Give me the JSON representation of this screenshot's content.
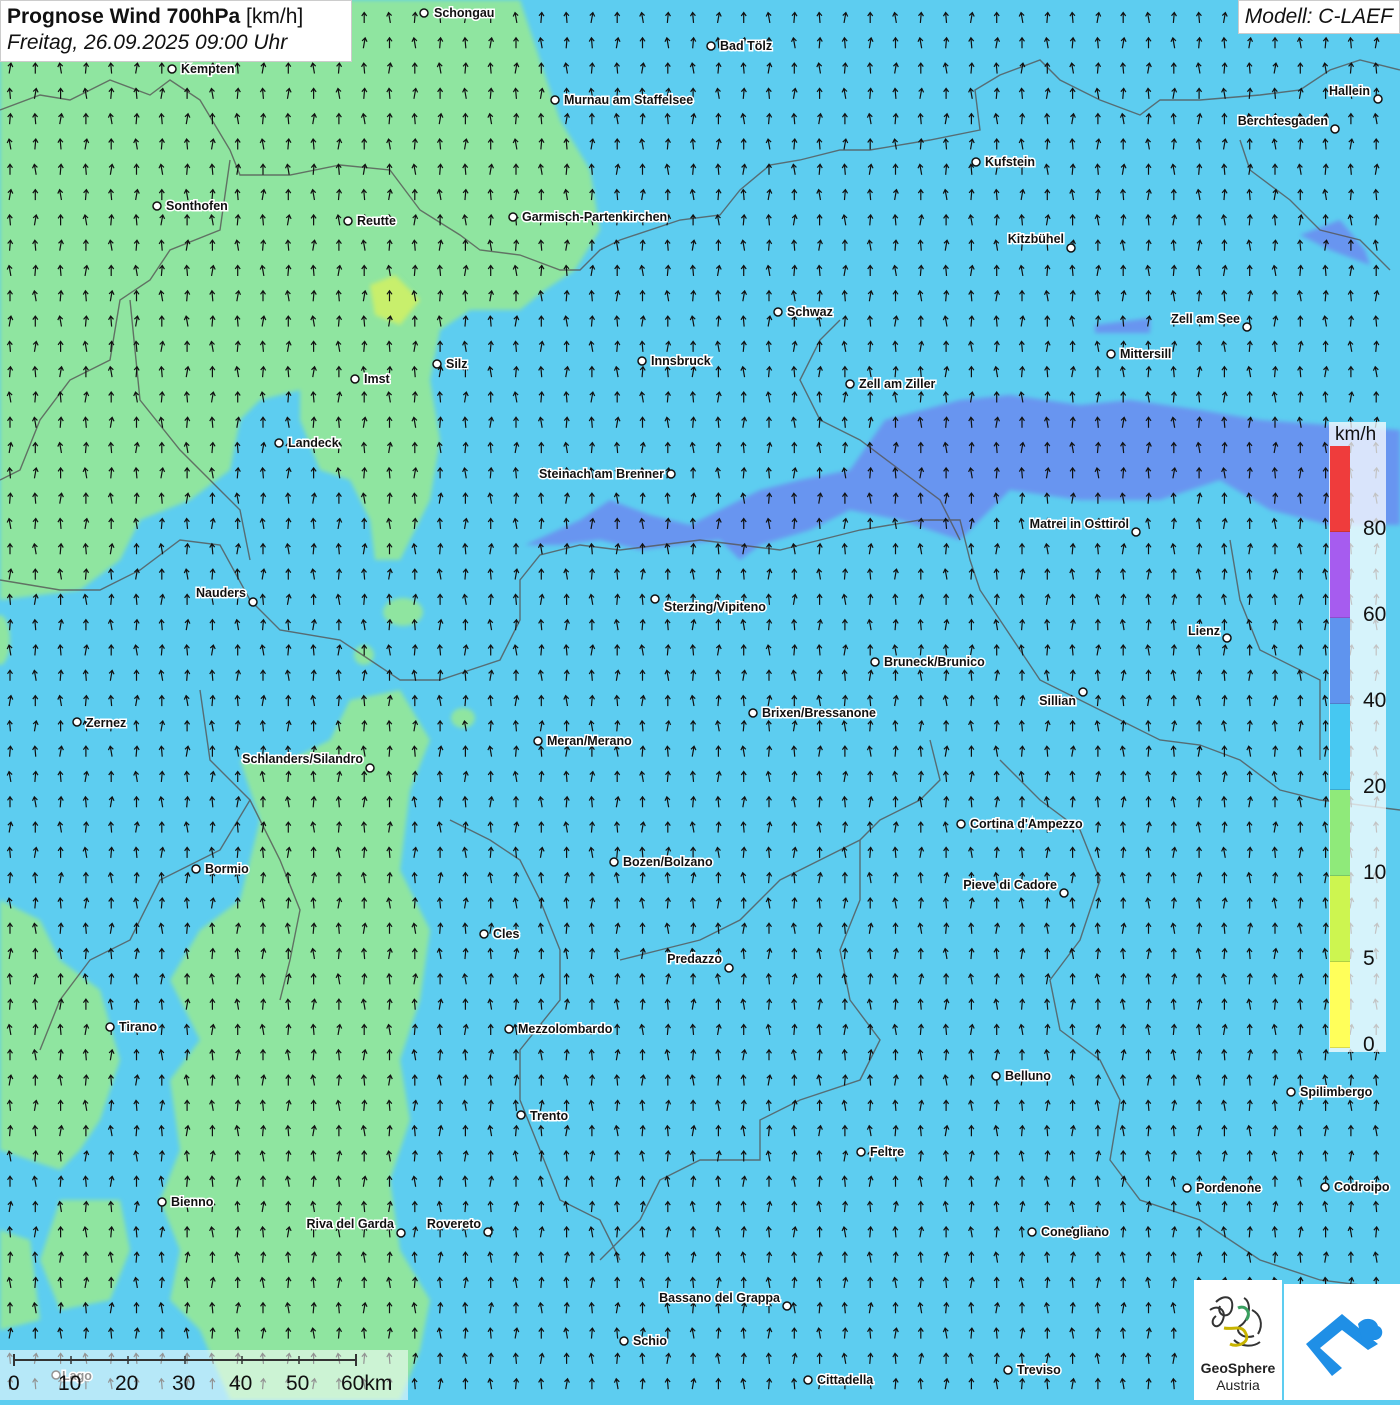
{
  "header": {
    "title_bold": "Prognose Wind 700hPa",
    "title_unit": "[km/h]",
    "datetime": "Freitag, 26.09.2025 09:00 Uhr"
  },
  "model": "Modell: C-LAEF",
  "legend": {
    "unit": "km/h",
    "stops": [
      {
        "label": "0",
        "color": "#ffff5a"
      },
      {
        "label": "5",
        "color": "#cdf550"
      },
      {
        "label": "10",
        "color": "#8fea7a"
      },
      {
        "label": "20",
        "color": "#46c8f2"
      },
      {
        "label": "40",
        "color": "#5f94ee"
      },
      {
        "label": "60",
        "color": "#a65cef"
      },
      {
        "label": "80",
        "color": "#ef3c3c"
      }
    ]
  },
  "scalebar": {
    "labels": [
      "0",
      "10",
      "20",
      "30",
      "40",
      "50",
      "60km"
    ]
  },
  "logo": {
    "name_bold": "GeoSphere",
    "name_sub": "Austria"
  },
  "colors": {
    "base_field": "#5dcdf0",
    "calm_field": "#8fe5a0",
    "strong_field": "#6a8ff0",
    "arrow": "#111111",
    "borders": "#555555"
  },
  "cities": [
    {
      "name": "Schongau"
    },
    {
      "name": "Bad Tölz"
    },
    {
      "name": "Kempten"
    },
    {
      "name": "Murnau am Staffelsee"
    },
    {
      "name": "Hallein"
    },
    {
      "name": "Berchtesgaden"
    },
    {
      "name": "Kufstein"
    },
    {
      "name": "Sonthofen"
    },
    {
      "name": "Reutte"
    },
    {
      "name": "Garmisch-Partenkirchen"
    },
    {
      "name": "Kitzbühel"
    },
    {
      "name": "Schwaz"
    },
    {
      "name": "Zell am See"
    },
    {
      "name": "Mittersill"
    },
    {
      "name": "Imst"
    },
    {
      "name": "Silz"
    },
    {
      "name": "Innsbruck"
    },
    {
      "name": "Zell am Ziller"
    },
    {
      "name": "Landeck"
    },
    {
      "name": "Steinach am Brenner"
    },
    {
      "name": "Matrei in Osttirol"
    },
    {
      "name": "Nauders"
    },
    {
      "name": "Sterzing/Vipiteno"
    },
    {
      "name": "Lienz"
    },
    {
      "name": "Bruneck/Brunico"
    },
    {
      "name": "Sillian"
    },
    {
      "name": "Zernez"
    },
    {
      "name": "Brixen/Bressanone"
    },
    {
      "name": "Meran/Merano"
    },
    {
      "name": "Schlanders/Silandro"
    },
    {
      "name": "Cortina d'Ampezzo"
    },
    {
      "name": "Bozen/Bolzano"
    },
    {
      "name": "Bormio"
    },
    {
      "name": "Pieve di Cadore"
    },
    {
      "name": "Cles"
    },
    {
      "name": "Predazzo"
    },
    {
      "name": "Tirano"
    },
    {
      "name": "Mezzolombardo"
    },
    {
      "name": "Belluno"
    },
    {
      "name": "Spilimbergo"
    },
    {
      "name": "Trento"
    },
    {
      "name": "Feltre"
    },
    {
      "name": "Pordenone"
    },
    {
      "name": "Codroipo"
    },
    {
      "name": "Bienno"
    },
    {
      "name": "Riva del Garda"
    },
    {
      "name": "Rovereto"
    },
    {
      "name": "Conegliano"
    },
    {
      "name": "Bassano del Grappa"
    },
    {
      "name": "Schio"
    },
    {
      "name": "Treviso"
    },
    {
      "name": "Cittadella"
    },
    {
      "name": "Lago"
    }
  ]
}
